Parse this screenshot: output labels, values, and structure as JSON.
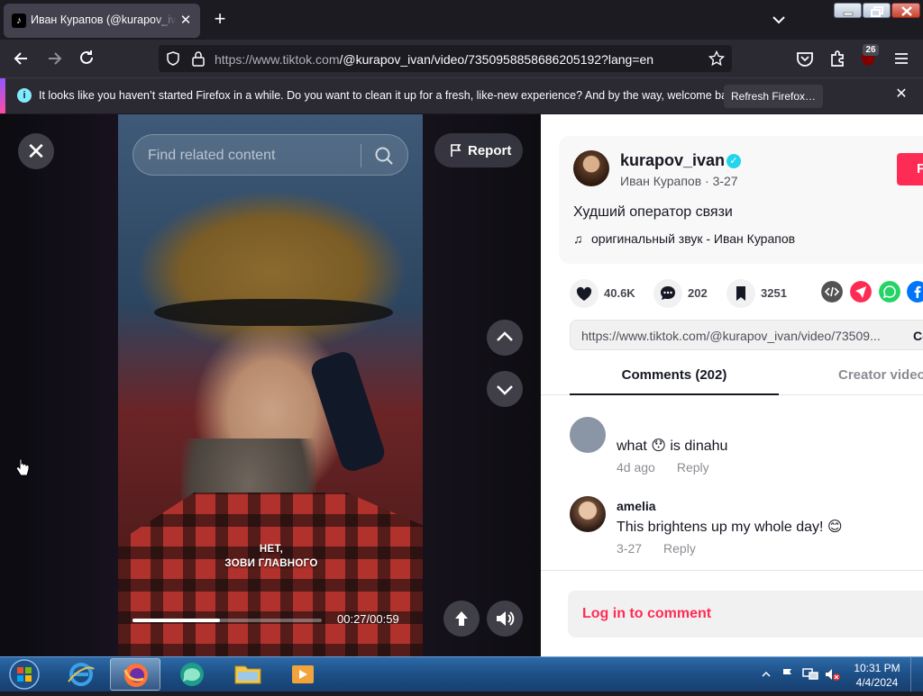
{
  "browser": {
    "tab_title": "Иван Курапов (@kurapov_ivan",
    "tab_close": "✕",
    "new_tab": "+",
    "url_host": "https://www.tiktok.com",
    "url_path": "/@kurapov_ivan/video/7350958858686205192?lang=en",
    "extension_badge": "26"
  },
  "notification": {
    "info_icon": "i",
    "text": "It looks like you haven’t started Firefox in a while. Do you want to clean it up for a fresh, like-new experience? And by the way, welcome back!",
    "button": "Refresh Firefox…",
    "close": "✕"
  },
  "video": {
    "close": "✕",
    "search_placeholder": "Find related content",
    "report": "Report",
    "subtitle_line1": "НЕТ,",
    "subtitle_line2": "ЗОВИ ГЛАВНОГО",
    "time": "00:27/00:59",
    "progress_fraction": 0.46
  },
  "post": {
    "username": "kurapov_ivan",
    "verified_icon": "✓",
    "nickname_date": "Иван Курапов · 3-27",
    "follow": "F",
    "caption": "Худший оператор связи",
    "music_icon": "♫",
    "music": "оригинальный звук - Иван Курапов",
    "likes": "40.6K",
    "comments": "202",
    "saves": "3251",
    "link": "https://www.tiktok.com/@kurapov_ivan/video/73509...",
    "copy_link": "Copy link"
  },
  "tabs": {
    "comments": "Comments (202)",
    "creator": "Creator videos"
  },
  "comments": [
    {
      "user": "",
      "text": "what 😯 is dinahu",
      "date": "4d ago",
      "reply": "Reply"
    },
    {
      "user": "amelia",
      "text": "This brightens up my whole day! 😊",
      "date": "3-27",
      "reply": "Reply"
    }
  ],
  "login": "Log in to comment",
  "taskbar": {
    "time": "10:31 PM",
    "date": "4/4/2024"
  },
  "colors": {
    "tiktok_red": "#fe2c55",
    "verified": "#20d5ec",
    "firefox_dark": "#1c1b22"
  }
}
